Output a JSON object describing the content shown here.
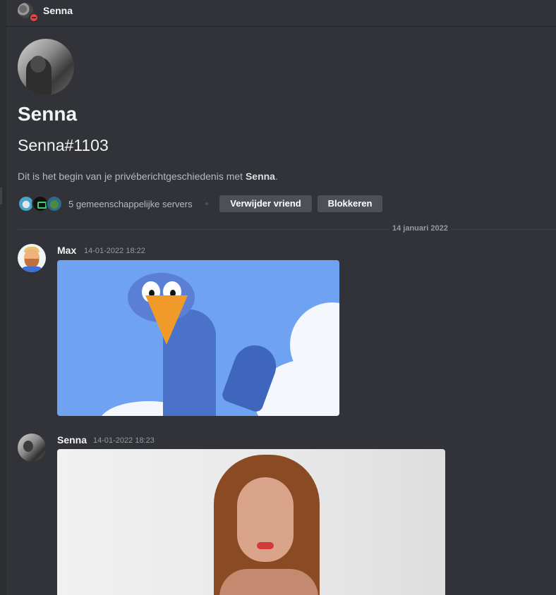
{
  "header": {
    "title": "Senna"
  },
  "profile": {
    "name": "Senna",
    "tag": "Senna#1103",
    "intro_prefix": "Dit is het begin van je privéberichtgeschiedenis met ",
    "intro_name": "Senna",
    "intro_suffix": ".",
    "mutual_servers": "5 gemeenschappelijke servers",
    "remove_friend_label": "Verwijder vriend",
    "block_label": "Blokkeren"
  },
  "divider": {
    "date": "14 januari 2022"
  },
  "messages": [
    {
      "author": "Max",
      "timestamp": "14-01-2022 18:22",
      "attachment": "animated-bird-gif"
    },
    {
      "author": "Senna",
      "timestamp": "14-01-2022 18:23",
      "attachment": "photo-of-woman"
    }
  ],
  "colors": {
    "background": "#313338",
    "button": "#4e5058",
    "status_dnd": "#f23f43",
    "muted_text": "#949ba4"
  }
}
